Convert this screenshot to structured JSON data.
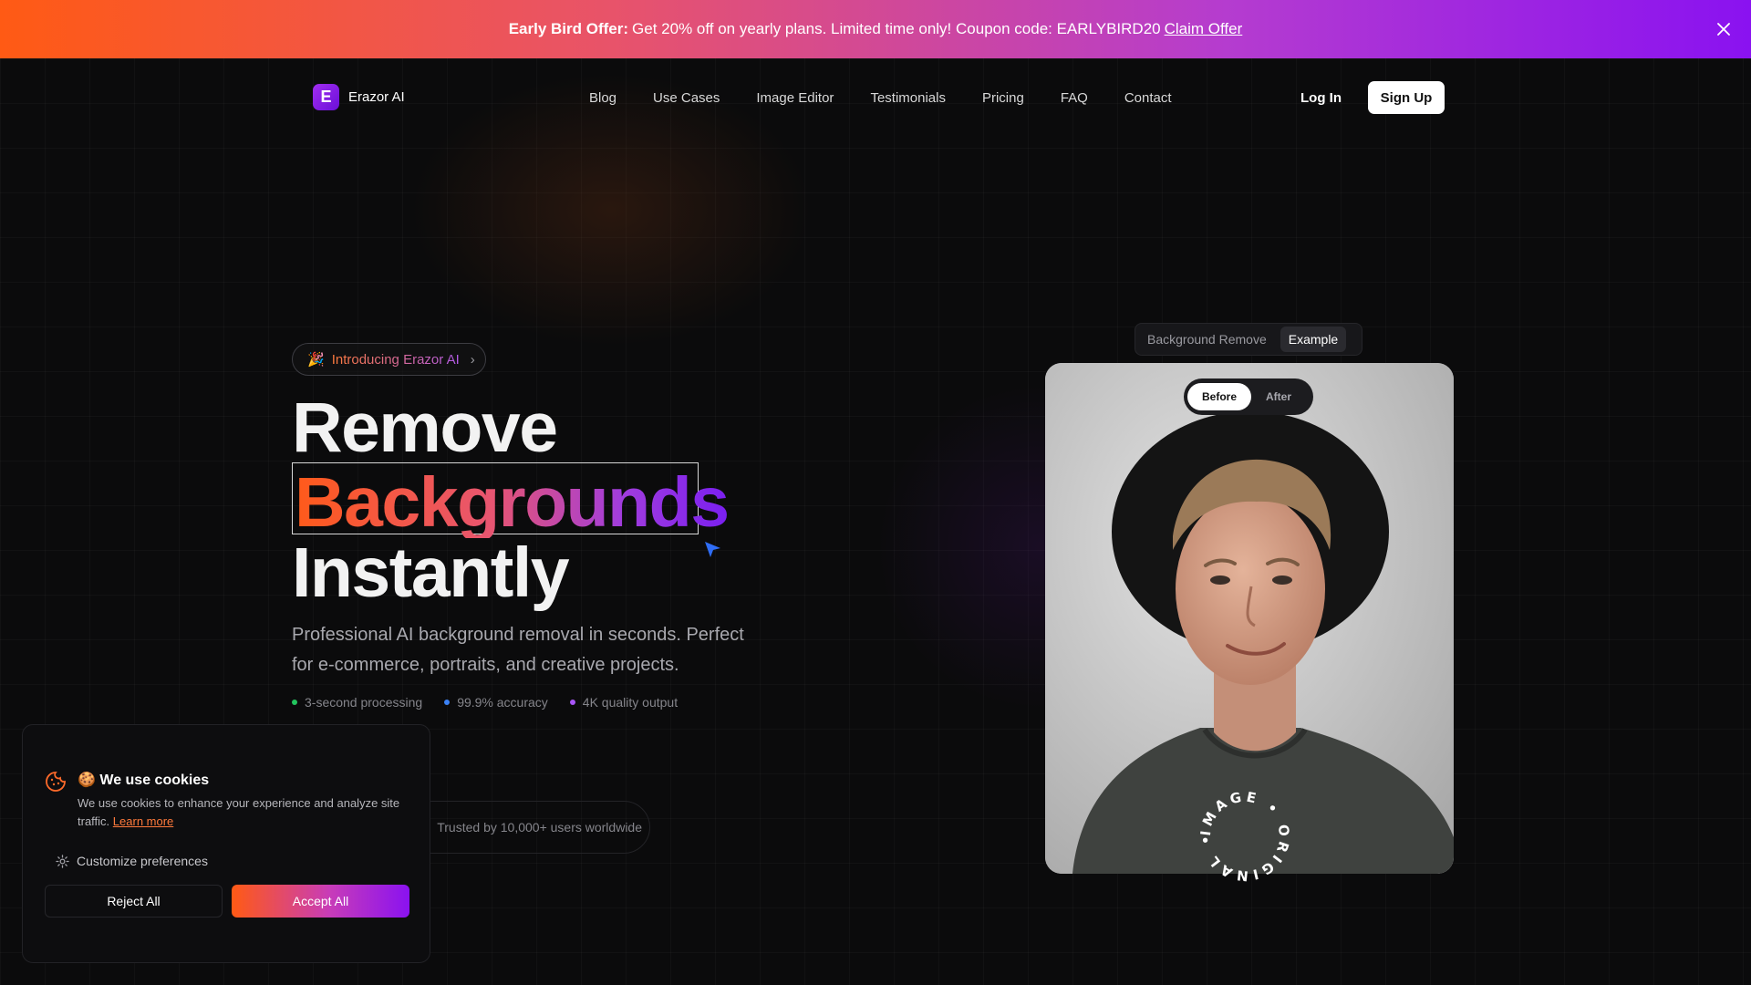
{
  "promo": {
    "bold": "Early Bird Offer:",
    "text": "Get 20% off on yearly plans. Limited time only! Coupon code: EARLYBIRD20",
    "link": "Claim Offer",
    "close_icon": "close-icon"
  },
  "nav": {
    "brand_letter": "E",
    "brand": "Erazor AI",
    "links": [
      "Blog",
      "Use Cases",
      "Image Editor",
      "Testimonials",
      "Pricing",
      "FAQ",
      "Contact"
    ],
    "login": "Log In",
    "signup": "Sign Up"
  },
  "hero": {
    "intro_emoji": "🎉",
    "intro": "Introducing Erazor AI",
    "intro_chevron": "›",
    "title_1": "Remove",
    "title_2": "Backgrounds",
    "title_3": "Instantly",
    "subtitle": "Professional AI background removal in seconds. Perfect for e-commerce, portraits, and creative projects.",
    "features": [
      {
        "label": "3-second processing",
        "color": "#22c55e"
      },
      {
        "label": "99.9% accuracy",
        "color": "#3b82f6"
      },
      {
        "label": "4K quality output",
        "color": "#a855f7"
      }
    ],
    "trusted": "Trusted by 10,000+ users worldwide"
  },
  "demo": {
    "tabs": [
      "Background Remove",
      "Example"
    ],
    "active_tab": "Example",
    "toggle": [
      "Before",
      "After"
    ],
    "active_toggle": "Before",
    "stamp_text": "IMAGE • ORIGINAL •"
  },
  "cookie": {
    "emoji": "🍪",
    "title": "We use cookies",
    "text": "We use cookies to enhance your experience and analyze site traffic.",
    "learn_more": "Learn more",
    "customize": "Customize preferences",
    "reject": "Reject All",
    "accept": "Accept All"
  },
  "colors": {
    "accent_orange": "#ff5a14",
    "accent_purple": "#8a12f0"
  }
}
